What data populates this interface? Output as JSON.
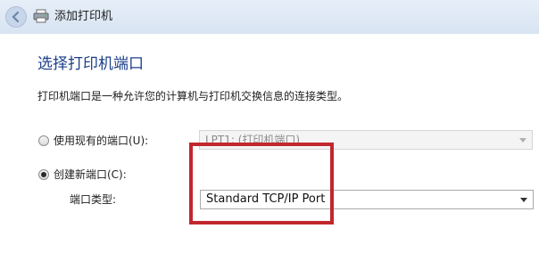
{
  "window": {
    "title": "添加打印机",
    "back_icon": "back-arrow-icon",
    "printer_icon": "printer-icon"
  },
  "main": {
    "heading": "选择打印机端口",
    "description": "打印机端口是一种允许您的计算机与打印机交换信息的连接类型。"
  },
  "options": {
    "existing_port": {
      "label": "使用现有的端口(U):",
      "selected": false,
      "dropdown_value": "LPT1: (打印机端口)"
    },
    "new_port": {
      "label": "创建新端口(C):",
      "selected": true,
      "type_label": "端口类型:",
      "dropdown_value": "Standard TCP/IP Port"
    }
  },
  "colors": {
    "heading": "#1c3f8a",
    "highlight": "#c1272d"
  }
}
